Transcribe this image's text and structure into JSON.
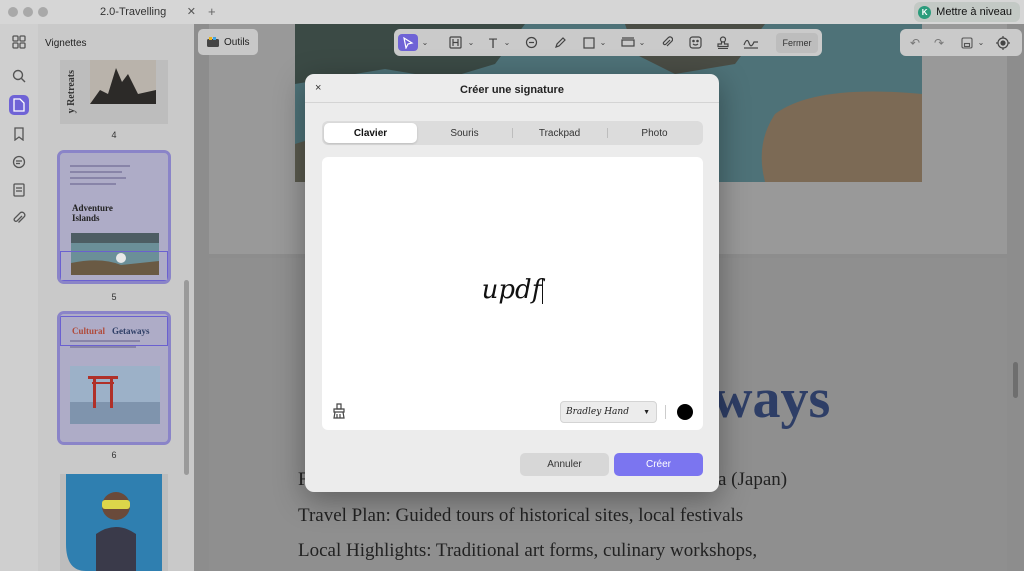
{
  "window": {
    "tab_title": "2.0-Travelling",
    "upgrade_label": "Mettre à niveau",
    "upgrade_badge": "K"
  },
  "thumbnails": {
    "panel_title": "Vignettes",
    "pages": [
      {
        "number": "4",
        "heading": "y Retreats"
      },
      {
        "number": "5",
        "heading_line1": "Adventure",
        "heading_line2": "Islands"
      },
      {
        "number": "6",
        "heading_word1": "Cultural",
        "heading_word2": "Getaways"
      },
      {
        "number": ""
      }
    ]
  },
  "toolbar": {
    "tools_label": "Outils",
    "close_label": "Fermer"
  },
  "document": {
    "headline_fragment": "ways",
    "lines": [
      {
        "start": "F",
        "end": "a (Japan)"
      },
      "Travel Plan: Guided tours of historical sites, local festivals",
      "Local Highlights: Traditional art forms, culinary workshops,"
    ]
  },
  "dialog": {
    "title": "Créer une signature",
    "close_glyph": "×",
    "tabs": [
      "Clavier",
      "Souris",
      "Trackpad",
      "Photo"
    ],
    "active_tab": "Clavier",
    "signature_text": "updf",
    "font_name": "Bradley Hand",
    "ink_color": "#000000",
    "cancel_label": "Annuler",
    "create_label": "Créer"
  },
  "colors": {
    "accent": "#6f63d6",
    "create_button": "#7b75f0",
    "heading_blue": "#2e3e66"
  }
}
